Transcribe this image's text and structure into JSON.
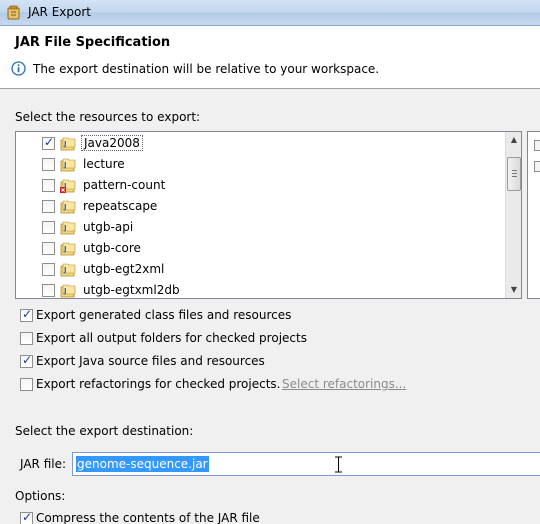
{
  "window": {
    "title": "JAR Export",
    "icon": "eclipse-jar-icon"
  },
  "header": {
    "title": "JAR File Specification",
    "message": "The export destination will be relative to your workspace.",
    "message_icon": "info-icon"
  },
  "resources": {
    "label": "Select the resources to export:",
    "projects": [
      {
        "name": "Java2008",
        "checked": true,
        "focused": true
      },
      {
        "name": "lecture",
        "checked": false
      },
      {
        "name": "pattern-count",
        "checked": false,
        "error": true
      },
      {
        "name": "repeatscape",
        "checked": false
      },
      {
        "name": "utgb-api",
        "checked": false
      },
      {
        "name": "utgb-core",
        "checked": false
      },
      {
        "name": "utgb-egt2xml",
        "checked": false
      },
      {
        "name": "utgb-egtxml2db",
        "checked": false
      }
    ]
  },
  "options_top": [
    {
      "label": "Export generated class files and resources",
      "checked": true
    },
    {
      "label": "Export all output folders for checked projects",
      "checked": false
    },
    {
      "label": "Export Java source files and resources",
      "checked": true
    },
    {
      "label": "Export refactorings for checked projects.",
      "checked": false
    }
  ],
  "select_refactorings_link": "Select refactorings...",
  "destination": {
    "label": "Select the export destination:",
    "jar_label": "JAR file:",
    "jar_value": "genome-sequence.jar"
  },
  "options": {
    "label": "Options:",
    "compress_label": "Compress the contents of the JAR file",
    "compress_checked": true
  }
}
